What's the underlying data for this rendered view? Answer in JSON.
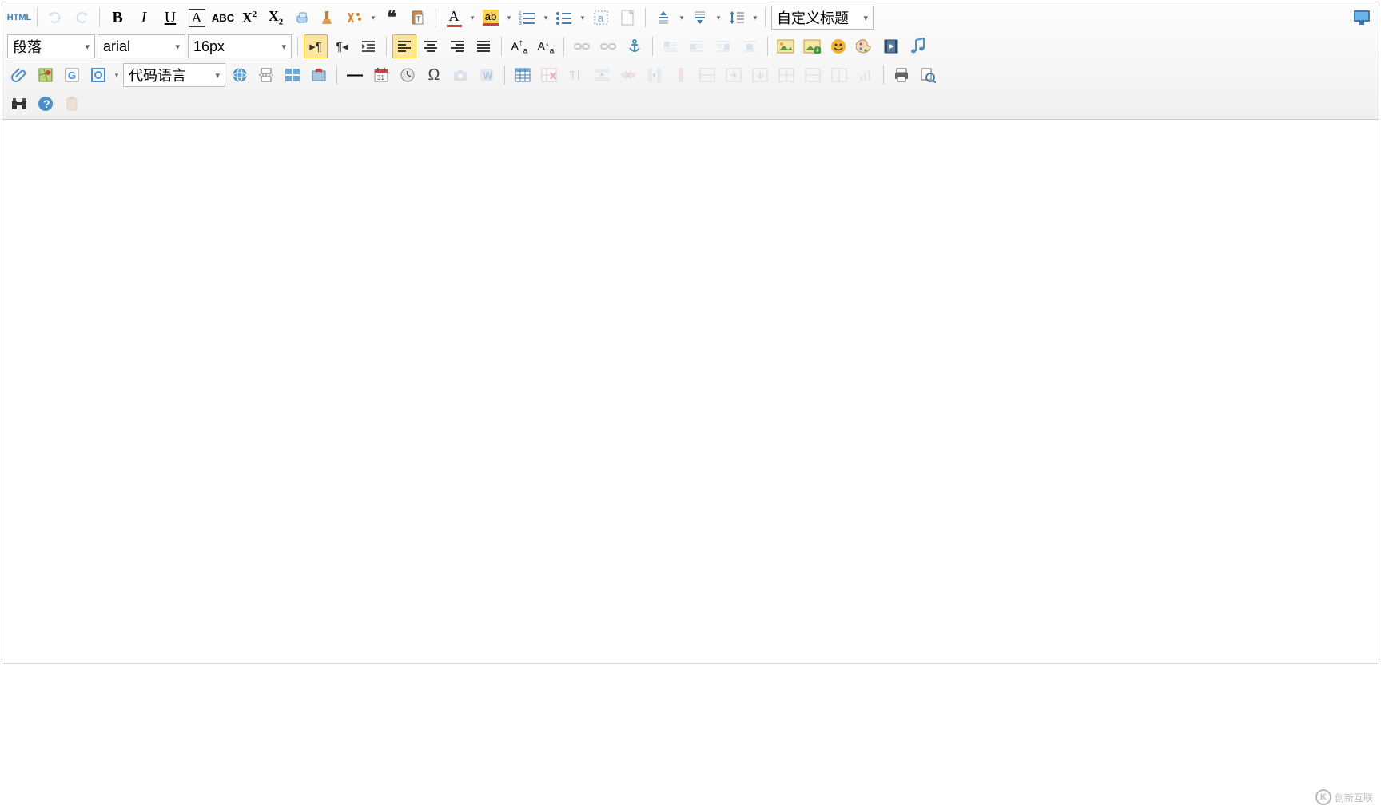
{
  "dropdowns": {
    "custom_title": "自定义标题",
    "paragraph": "段落",
    "font_family": "arial",
    "font_size": "16px",
    "code_lang": "代码语言"
  },
  "watermark": {
    "brand": "创新互联",
    "icon_letter": "K"
  },
  "icons": {
    "html": "HTML",
    "undo": "undo",
    "redo": "redo",
    "bold": "B",
    "italic": "I",
    "underline": "U",
    "fontborder": "A",
    "strike": "ABC",
    "sup": "X²",
    "sub": "X₂",
    "eraser": "eraser",
    "brush": "brush",
    "autotype": "autotype",
    "quote": "❝❝",
    "pasteplain": "paste",
    "forecolor": "A",
    "backcolor": "ab",
    "ol": "ol",
    "ul": "ul",
    "selectall": "selectall",
    "blank": "blank",
    "rowspace": "rowspace",
    "lineheight": "lineheight",
    "indent": "indent",
    "preview": "preview",
    "ltr": "▶¶",
    "rtl": "¶◀",
    "in": "indent",
    "jl": "jleft",
    "jc": "jcenter",
    "jr": "jright",
    "jj": "jjust",
    "toupper": "Aa↑",
    "tolower": "Aa↓",
    "link": "link",
    "unlink": "unlink",
    "anchor": "anchor",
    "fl": "float-l",
    "fr": "float-r",
    "fn": "float-n",
    "fc": "float-c",
    "img": "image",
    "multi": "multi-img",
    "emoji": "emoji",
    "palette": "palette",
    "video": "video",
    "music": "music",
    "attach": "attach",
    "map": "map",
    "gmap": "gmap",
    "frame": "frame",
    "hr": "—",
    "date": "date",
    "time": "time",
    "omega": "Ω",
    "snap": "snap",
    "word": "word",
    "table": "table",
    "delt": "del-table",
    "cap": "caption",
    "ir": "ins-row",
    "dr": "del-row",
    "splitc": "split-c",
    "mt": "merge-t",
    "ml": "merge-l",
    "mr": "merge-r",
    "ic": "ins-col",
    "dc": "del-col",
    "chart": "chart",
    "print": "print",
    "find": "find",
    "bino": "bino",
    "help": "help",
    "clip": "clip"
  }
}
